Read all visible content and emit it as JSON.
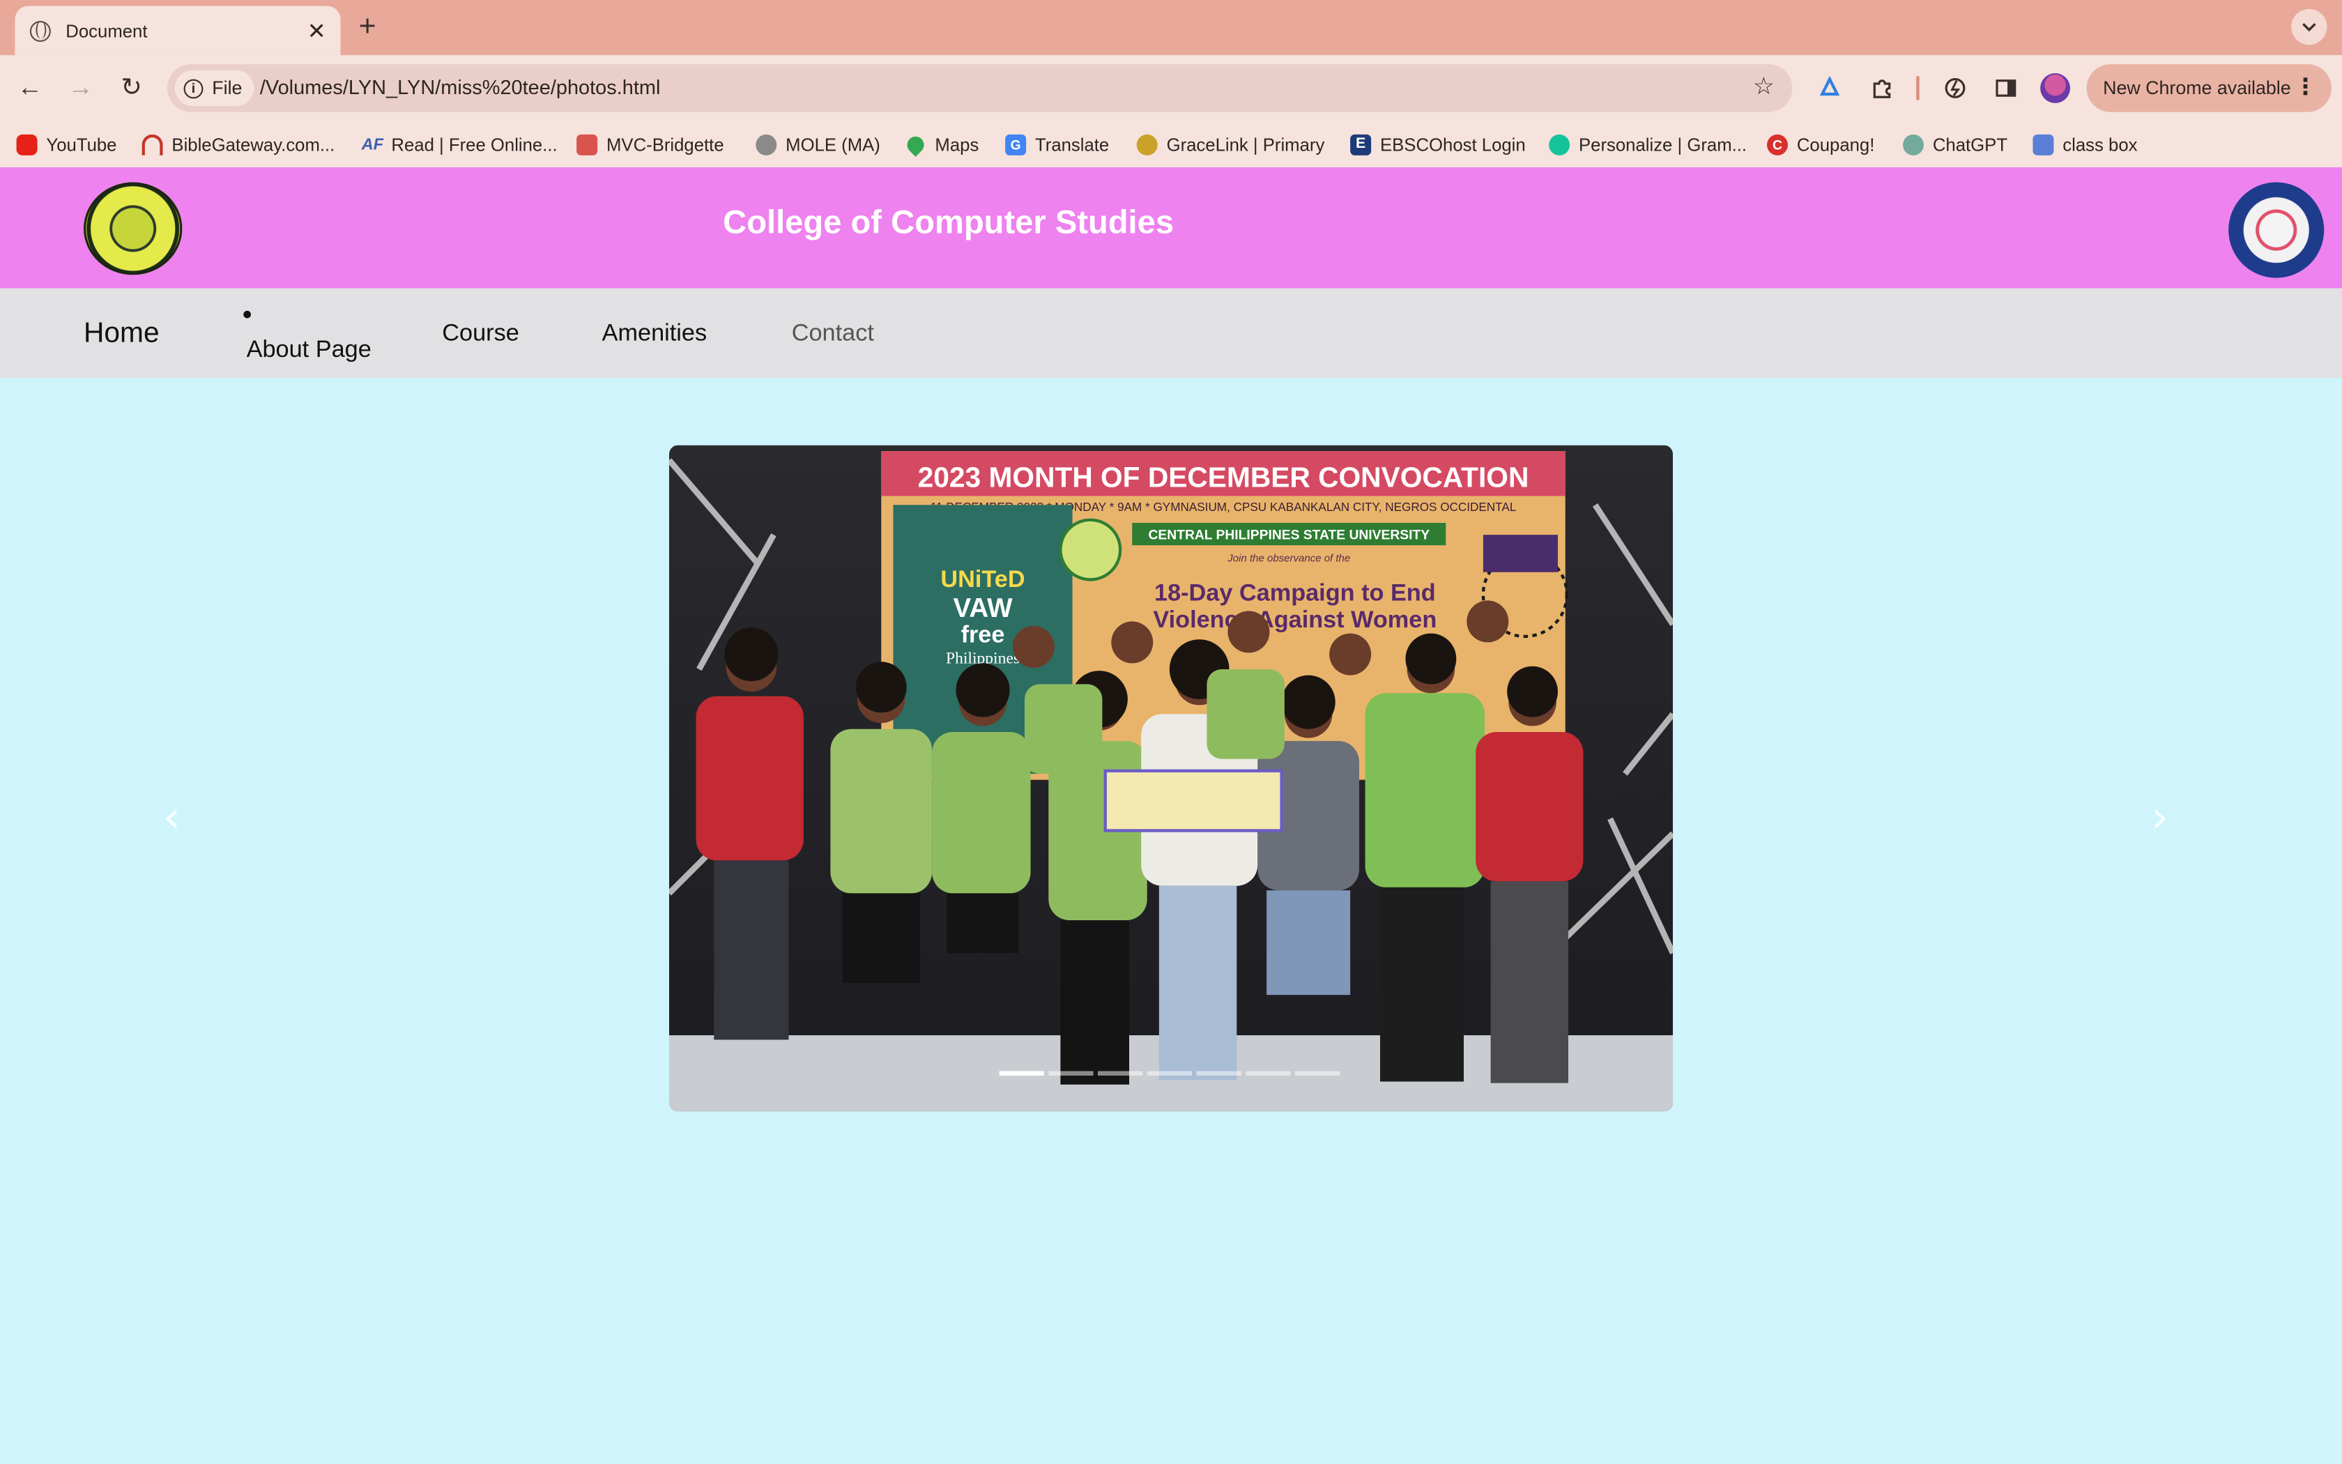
{
  "browser": {
    "tab_title": "Document",
    "tab_close": "✕",
    "new_tab": "+",
    "tab_search_icon": "chevron-down-icon",
    "back": "←",
    "forward": "→",
    "reload": "↻",
    "site_chip": "File",
    "url": "/Volumes/LYN_LYN/miss%20tee/photos.html",
    "bookmark_star": "☆",
    "update_label": "New Chrome available",
    "menu": "⋮",
    "bookmarks": [
      {
        "label": "YouTube",
        "color": "#e62117"
      },
      {
        "label": "BibleGateway.com...",
        "color": "#c2362b"
      },
      {
        "label": "Read | Free Online...",
        "color": "#3a5fb0"
      },
      {
        "label": "MVC-Bridgette",
        "color": "#d9534f"
      },
      {
        "label": "MOLE (MA)",
        "color": "#6b6b6b"
      },
      {
        "label": "Maps",
        "color": "#34a853"
      },
      {
        "label": "Translate",
        "color": "#4285f4"
      },
      {
        "label": "GraceLink | Primary",
        "color": "#c9a227"
      },
      {
        "label": "EBSCOhost Login",
        "color": "#1d3b78"
      },
      {
        "label": "Personalize | Gram...",
        "color": "#15c39a"
      },
      {
        "label": "Coupang!",
        "color": "#d9302c"
      },
      {
        "label": "ChatGPT",
        "color": "#74aa9c"
      },
      {
        "label": "class box",
        "color": "#5b7fd6"
      }
    ]
  },
  "header": {
    "title": "College of Computer Studies"
  },
  "nav": {
    "home": "Home",
    "about": "About Page",
    "course": "Course",
    "amenities": "Amenities",
    "contact": "Contact"
  },
  "carousel": {
    "slide_count": 7,
    "active_index": 0,
    "prev_icon": "‹",
    "next_icon": "›",
    "banner_title": "2023 MONTH OF DECEMBER CONVOCATION",
    "banner_sub": "11 DECEMBER 2023 * MONDAY * 9AM * GYMNASIUM, CPSU KABANKALAN CITY, NEGROS OCCIDENTAL",
    "banner_org": "CENTRAL PHILIPPINES STATE UNIVERSITY",
    "banner_join": "Join the observance of the",
    "banner_campaign_1": "18-Day Campaign to End",
    "banner_campaign_2": "Violence Against Women",
    "poster_1": "UNiTeD",
    "poster_2": "VAW",
    "poster_3": "free",
    "poster_4": "Philippines"
  },
  "colors": {
    "header_bg": "#ee82ee",
    "nav_bg": "#e1e1e3",
    "page_bg": "#cff4fc",
    "tabstrip_bg": "#e8a99a"
  }
}
